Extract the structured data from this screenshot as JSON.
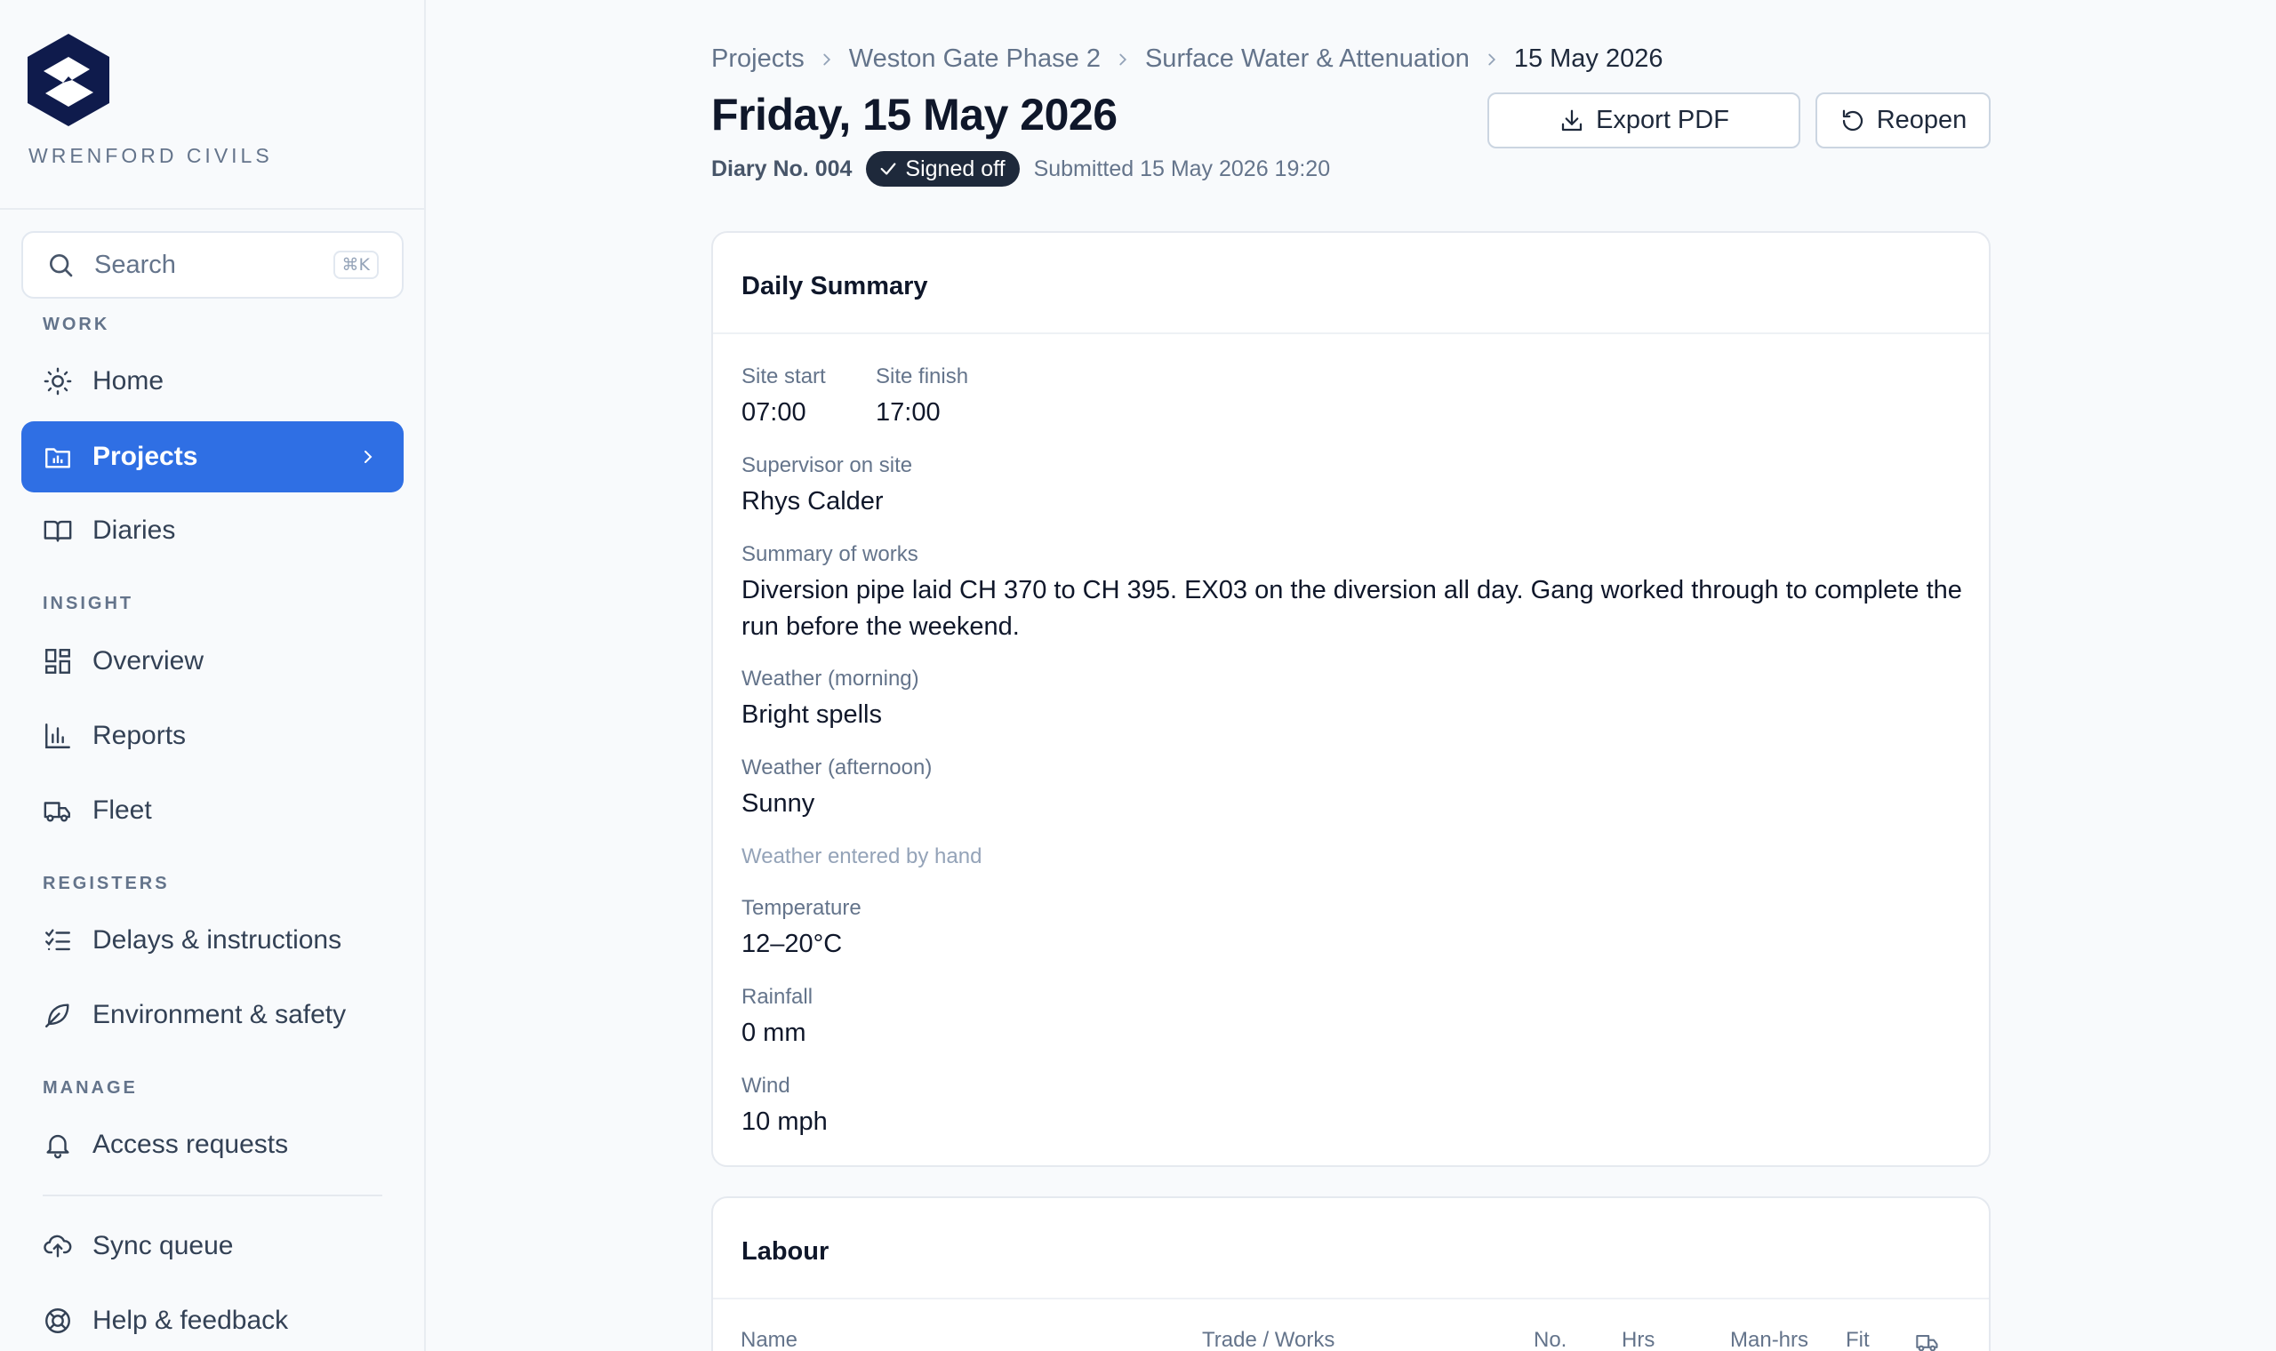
{
  "brand": {
    "name": "WRENFORD CIVILS",
    "logo_icon": "wrenford-logo-icon"
  },
  "search": {
    "placeholder": "Search",
    "shortcut": "⌘K"
  },
  "nav": {
    "sections": {
      "work": "WORK",
      "insight": "INSIGHT",
      "registers": "REGISTERS",
      "manage": "MANAGE"
    },
    "items": {
      "home": "Home",
      "projects": "Projects",
      "diaries": "Diaries",
      "overview": "Overview",
      "reports": "Reports",
      "fleet": "Fleet",
      "delays": "Delays & instructions",
      "environment": "Environment & safety",
      "access": "Access requests",
      "sync": "Sync queue",
      "help": "Help & feedback"
    },
    "active": "projects"
  },
  "breadcrumb": [
    "Projects",
    "Weston Gate Phase 2",
    "Surface Water & Attenuation",
    "15 May 2026"
  ],
  "page": {
    "title": "Friday, 15 May 2026",
    "diary_no": "Diary No. 004",
    "status": "Signed off",
    "submitted": "Submitted 15 May 2026 19:20"
  },
  "actions": {
    "export": "Export PDF",
    "reopen": "Reopen"
  },
  "summary": {
    "title": "Daily Summary",
    "site_start_label": "Site start",
    "site_start": "07:00",
    "site_finish_label": "Site finish",
    "site_finish": "17:00",
    "supervisor_label": "Supervisor on site",
    "supervisor": "Rhys Calder",
    "works_label": "Summary of works",
    "works": "Diversion pipe laid CH 370 to CH 395. EX03 on the diversion all day. Gang worked through to complete the run before the weekend.",
    "weather_am_label": "Weather (morning)",
    "weather_am": "Bright spells",
    "weather_pm_label": "Weather (afternoon)",
    "weather_pm": "Sunny",
    "weather_note": "Weather entered by hand",
    "temperature_label": "Temperature",
    "temperature": "12–20°C",
    "rainfall_label": "Rainfall",
    "rainfall": "0 mm",
    "wind_label": "Wind",
    "wind": "10 mph"
  },
  "labour": {
    "title": "Labour",
    "columns": {
      "name": "Name",
      "trade": "Trade / Works",
      "no": "No.",
      "hrs": "Hrs",
      "manhrs": "Man-hrs",
      "fit": "Fit",
      "plant_icon": "truck-icon"
    }
  },
  "colors": {
    "accent": "#2f6fe4",
    "brand": "#0f1b4c",
    "badge": "#1e293b"
  }
}
